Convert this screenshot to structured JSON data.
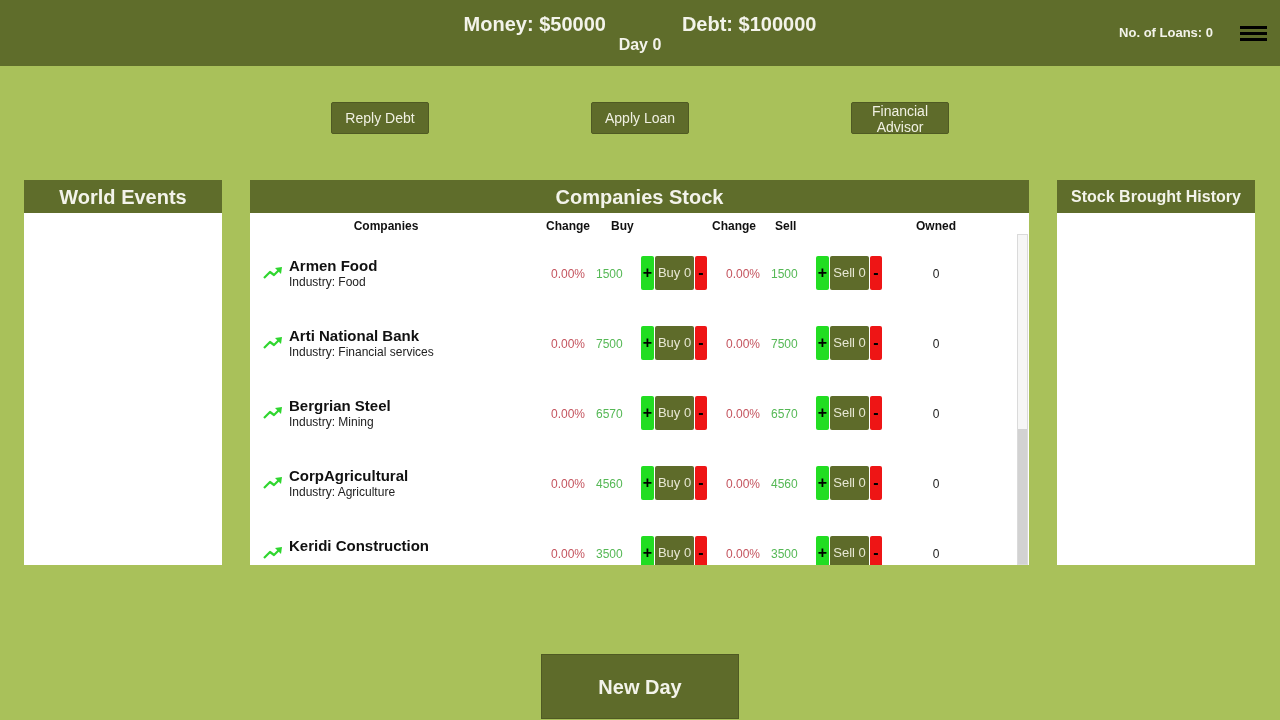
{
  "header": {
    "money": "Money: $50000",
    "debt": "Debt: $100000",
    "day": "Day 0",
    "loans": "No. of Loans: 0"
  },
  "actions": [
    "Reply Debt",
    "Apply Loan",
    "Financial Advisor"
  ],
  "world_events": {
    "title": "World Events"
  },
  "companies_stock": {
    "title": "Companies Stock",
    "columns": [
      "Companies",
      "Change",
      "Buy",
      "Change",
      "Sell",
      "Owned"
    ],
    "rows": [
      {
        "name": "Armen Food",
        "industry": "Industry: Food",
        "buy": {
          "change": "0.00%",
          "price": "1500",
          "plus": "+",
          "label": "Buy 0",
          "minus": "-"
        },
        "sell": {
          "change": "0.00%",
          "price": "1500",
          "plus": "+",
          "label": "Sell 0",
          "minus": "-"
        },
        "owned": "0"
      },
      {
        "name": "Arti National Bank",
        "industry": "Industry: Financial services",
        "buy": {
          "change": "0.00%",
          "price": "7500",
          "plus": "+",
          "label": "Buy 0",
          "minus": "-"
        },
        "sell": {
          "change": "0.00%",
          "price": "7500",
          "plus": "+",
          "label": "Sell 0",
          "minus": "-"
        },
        "owned": "0"
      },
      {
        "name": "Bergrian Steel",
        "industry": "Industry: Mining",
        "buy": {
          "change": "0.00%",
          "price": "6570",
          "plus": "+",
          "label": "Buy 0",
          "minus": "-"
        },
        "sell": {
          "change": "0.00%",
          "price": "6570",
          "plus": "+",
          "label": "Sell 0",
          "minus": "-"
        },
        "owned": "0"
      },
      {
        "name": "CorpAgricultural",
        "industry": "Industry: Agriculture",
        "buy": {
          "change": "0.00%",
          "price": "4560",
          "plus": "+",
          "label": "Buy 0",
          "minus": "-"
        },
        "sell": {
          "change": "0.00%",
          "price": "4560",
          "plus": "+",
          "label": "Sell 0",
          "minus": "-"
        },
        "owned": "0"
      },
      {
        "name": "Keridi Construction",
        "buy": {
          "change": "0.00%",
          "price": "3500",
          "plus": "+",
          "label": "Buy 0",
          "minus": "-"
        },
        "sell": {
          "change": "0.00%",
          "price": "3500",
          "plus": "+",
          "label": "Sell 0",
          "minus": "-"
        },
        "owned": "0"
      }
    ]
  },
  "stock_history": {
    "title": "Stock Brought History"
  },
  "new_day": "New Day"
}
